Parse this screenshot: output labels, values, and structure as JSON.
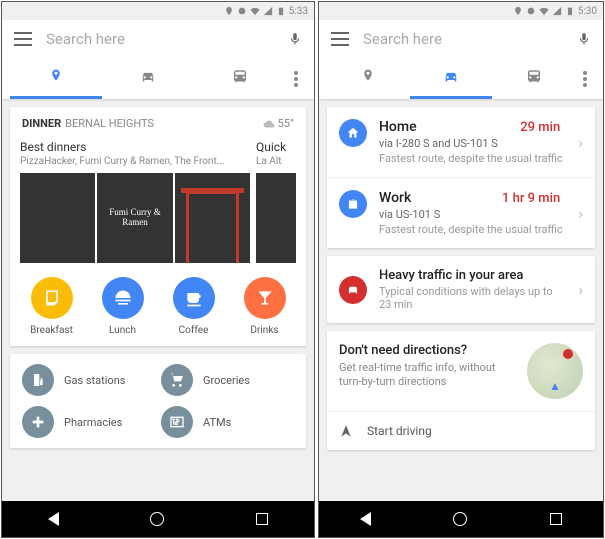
{
  "status": {
    "time_left": "5:33",
    "time_right": "5:30"
  },
  "search": {
    "placeholder": "Search here"
  },
  "left": {
    "dinner": {
      "title": "DINNER",
      "location": "BERNAL HEIGHTS",
      "temp": "55°",
      "main": {
        "title": "Best dinners",
        "sub": "PizzaHacker, Fumi Curry & Ramen, The Front...",
        "sign": "Fumi Curry & Ramen"
      },
      "peek": {
        "title": "Quick",
        "sub": "La Alt"
      }
    },
    "cats": [
      {
        "label": "Breakfast",
        "color": "#FBBC05"
      },
      {
        "label": "Lunch",
        "color": "#4285F4"
      },
      {
        "label": "Coffee",
        "color": "#4285F4"
      },
      {
        "label": "Drinks",
        "color": "#FF7043"
      }
    ],
    "svcs": [
      "Gas stations",
      "Groceries",
      "Pharmacies",
      "ATMs"
    ]
  },
  "right": {
    "dests": [
      {
        "name": "Home",
        "time": "29 min",
        "via": "via I-280 S and US-101 S",
        "note": "Fastest route, despite the usual traffic",
        "color": "#4285F4"
      },
      {
        "name": "Work",
        "time": "1 hr 9 min",
        "via": "via US-101 S",
        "note": "Fastest route, despite the usual traffic",
        "color": "#4285F4"
      }
    ],
    "traffic": {
      "title": "Heavy traffic in your area",
      "sub": "Typical conditions with delays up to 23 min"
    },
    "promo": {
      "title": "Don't need directions?",
      "text": "Get real-time traffic info, without turn-by-turn directions"
    },
    "start": "Start driving"
  }
}
